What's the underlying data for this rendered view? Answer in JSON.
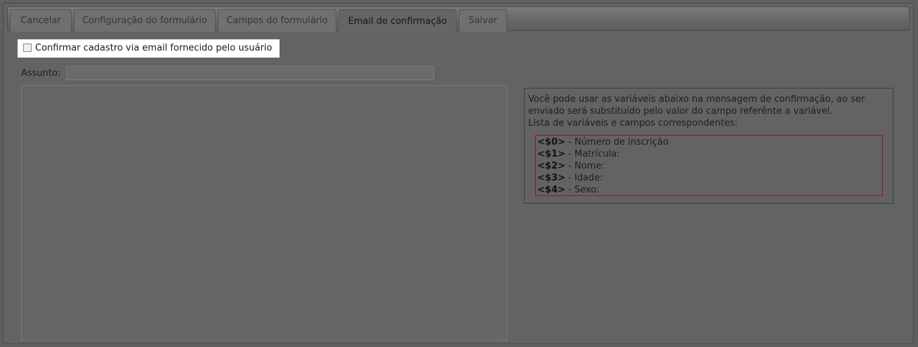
{
  "tabs": [
    {
      "label": "Cancelar"
    },
    {
      "label": "Configuração do formulário"
    },
    {
      "label": "Campos do formulário"
    },
    {
      "label": "Email de confirmação"
    },
    {
      "label": "Salvar"
    }
  ],
  "active_tab": "Email de confirmação",
  "confirm_checkbox": {
    "label": "Confirmar cadastro via email fornecido pelo usuário",
    "checked": false
  },
  "subject": {
    "label": "Assunto:",
    "value": ""
  },
  "message_body": {
    "value": ""
  },
  "info": {
    "line1": "Você pode usar as variáveis abaixo na mensagem de confirmação, ao ser",
    "line2": "enviado será substituído pelo valor do campo referênte a variável.",
    "line3": "Lista de variáveis e campos correspondentes:",
    "variables": [
      {
        "code": "<$0>",
        "desc": " - Número de inscrição"
      },
      {
        "code": "<$1>",
        "desc": " - Matrícula:"
      },
      {
        "code": "<$2>",
        "desc": " - Nome:"
      },
      {
        "code": "<$3>",
        "desc": " - Idade:"
      },
      {
        "code": "<$4>",
        "desc": " - Sexo:"
      }
    ]
  }
}
